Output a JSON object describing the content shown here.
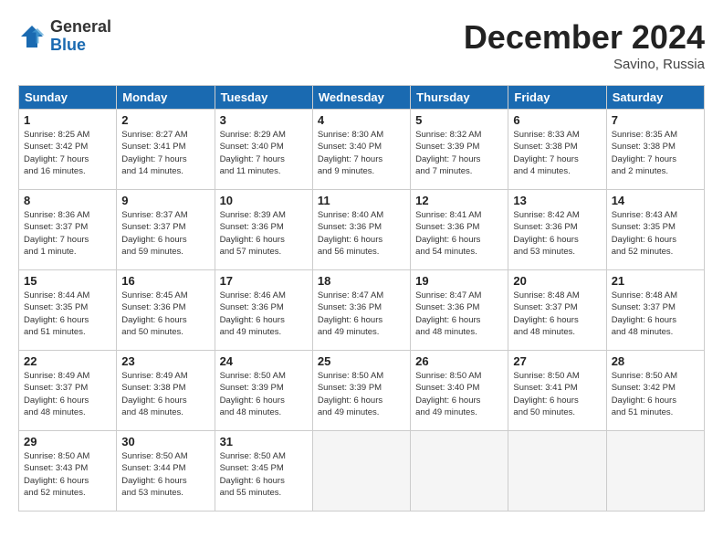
{
  "logo": {
    "general": "General",
    "blue": "Blue"
  },
  "header": {
    "month": "December 2024",
    "location": "Savino, Russia"
  },
  "weekdays": [
    "Sunday",
    "Monday",
    "Tuesday",
    "Wednesday",
    "Thursday",
    "Friday",
    "Saturday"
  ],
  "weeks": [
    [
      {
        "day": "1",
        "info": "Sunrise: 8:25 AM\nSunset: 3:42 PM\nDaylight: 7 hours\nand 16 minutes."
      },
      {
        "day": "2",
        "info": "Sunrise: 8:27 AM\nSunset: 3:41 PM\nDaylight: 7 hours\nand 14 minutes."
      },
      {
        "day": "3",
        "info": "Sunrise: 8:29 AM\nSunset: 3:40 PM\nDaylight: 7 hours\nand 11 minutes."
      },
      {
        "day": "4",
        "info": "Sunrise: 8:30 AM\nSunset: 3:40 PM\nDaylight: 7 hours\nand 9 minutes."
      },
      {
        "day": "5",
        "info": "Sunrise: 8:32 AM\nSunset: 3:39 PM\nDaylight: 7 hours\nand 7 minutes."
      },
      {
        "day": "6",
        "info": "Sunrise: 8:33 AM\nSunset: 3:38 PM\nDaylight: 7 hours\nand 4 minutes."
      },
      {
        "day": "7",
        "info": "Sunrise: 8:35 AM\nSunset: 3:38 PM\nDaylight: 7 hours\nand 2 minutes."
      }
    ],
    [
      {
        "day": "8",
        "info": "Sunrise: 8:36 AM\nSunset: 3:37 PM\nDaylight: 7 hours\nand 1 minute."
      },
      {
        "day": "9",
        "info": "Sunrise: 8:37 AM\nSunset: 3:37 PM\nDaylight: 6 hours\nand 59 minutes."
      },
      {
        "day": "10",
        "info": "Sunrise: 8:39 AM\nSunset: 3:36 PM\nDaylight: 6 hours\nand 57 minutes."
      },
      {
        "day": "11",
        "info": "Sunrise: 8:40 AM\nSunset: 3:36 PM\nDaylight: 6 hours\nand 56 minutes."
      },
      {
        "day": "12",
        "info": "Sunrise: 8:41 AM\nSunset: 3:36 PM\nDaylight: 6 hours\nand 54 minutes."
      },
      {
        "day": "13",
        "info": "Sunrise: 8:42 AM\nSunset: 3:36 PM\nDaylight: 6 hours\nand 53 minutes."
      },
      {
        "day": "14",
        "info": "Sunrise: 8:43 AM\nSunset: 3:35 PM\nDaylight: 6 hours\nand 52 minutes."
      }
    ],
    [
      {
        "day": "15",
        "info": "Sunrise: 8:44 AM\nSunset: 3:35 PM\nDaylight: 6 hours\nand 51 minutes."
      },
      {
        "day": "16",
        "info": "Sunrise: 8:45 AM\nSunset: 3:36 PM\nDaylight: 6 hours\nand 50 minutes."
      },
      {
        "day": "17",
        "info": "Sunrise: 8:46 AM\nSunset: 3:36 PM\nDaylight: 6 hours\nand 49 minutes."
      },
      {
        "day": "18",
        "info": "Sunrise: 8:47 AM\nSunset: 3:36 PM\nDaylight: 6 hours\nand 49 minutes."
      },
      {
        "day": "19",
        "info": "Sunrise: 8:47 AM\nSunset: 3:36 PM\nDaylight: 6 hours\nand 48 minutes."
      },
      {
        "day": "20",
        "info": "Sunrise: 8:48 AM\nSunset: 3:37 PM\nDaylight: 6 hours\nand 48 minutes."
      },
      {
        "day": "21",
        "info": "Sunrise: 8:48 AM\nSunset: 3:37 PM\nDaylight: 6 hours\nand 48 minutes."
      }
    ],
    [
      {
        "day": "22",
        "info": "Sunrise: 8:49 AM\nSunset: 3:37 PM\nDaylight: 6 hours\nand 48 minutes."
      },
      {
        "day": "23",
        "info": "Sunrise: 8:49 AM\nSunset: 3:38 PM\nDaylight: 6 hours\nand 48 minutes."
      },
      {
        "day": "24",
        "info": "Sunrise: 8:50 AM\nSunset: 3:39 PM\nDaylight: 6 hours\nand 48 minutes."
      },
      {
        "day": "25",
        "info": "Sunrise: 8:50 AM\nSunset: 3:39 PM\nDaylight: 6 hours\nand 49 minutes."
      },
      {
        "day": "26",
        "info": "Sunrise: 8:50 AM\nSunset: 3:40 PM\nDaylight: 6 hours\nand 49 minutes."
      },
      {
        "day": "27",
        "info": "Sunrise: 8:50 AM\nSunset: 3:41 PM\nDaylight: 6 hours\nand 50 minutes."
      },
      {
        "day": "28",
        "info": "Sunrise: 8:50 AM\nSunset: 3:42 PM\nDaylight: 6 hours\nand 51 minutes."
      }
    ],
    [
      {
        "day": "29",
        "info": "Sunrise: 8:50 AM\nSunset: 3:43 PM\nDaylight: 6 hours\nand 52 minutes."
      },
      {
        "day": "30",
        "info": "Sunrise: 8:50 AM\nSunset: 3:44 PM\nDaylight: 6 hours\nand 53 minutes."
      },
      {
        "day": "31",
        "info": "Sunrise: 8:50 AM\nSunset: 3:45 PM\nDaylight: 6 hours\nand 55 minutes."
      },
      null,
      null,
      null,
      null
    ]
  ]
}
